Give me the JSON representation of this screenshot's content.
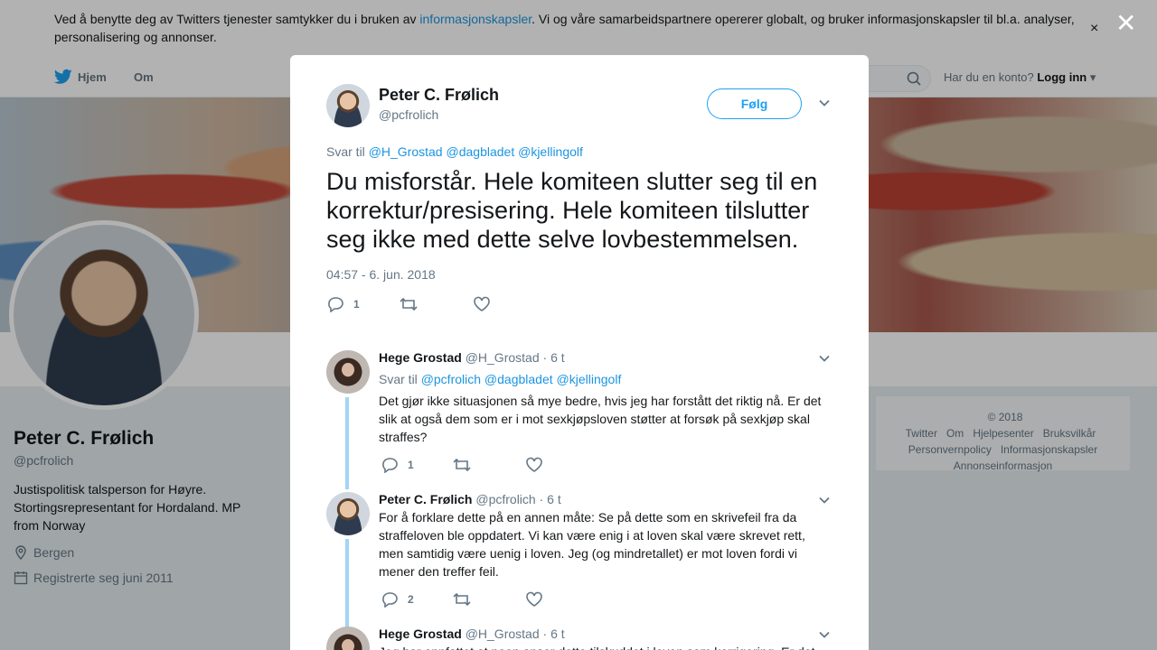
{
  "cookie": {
    "text_before": "Ved å benytte deg av Twitters tjenester samtykker du i bruken av ",
    "link": "informasjonskapsler",
    "text_after": ". Vi og våre samarbeidspartnere opererer globalt, og bruker informasjonskapsler til bl.a. analyser, personalisering og annonser.",
    "close": "×"
  },
  "modal_close": "✕",
  "nav": {
    "home": "Hjem",
    "about": "Om",
    "account_prompt": "Har du en konto? ",
    "login": "Logg inn"
  },
  "profile": {
    "name": "Peter C. Frølich",
    "handle": "@pcfrolich",
    "bio": "Justispolitisk talsperson for Høyre. Stortingsrepresentant for Hordaland. MP from Norway",
    "location": "Bergen",
    "joined": "Registrerte seg juni 2011"
  },
  "footer": [
    "© 2018 Twitter",
    "Om",
    "Hjelpesenter",
    "Bruksvilkår",
    "Personvernpolicy",
    "Informasjonskapsler",
    "Annonseinformasjon"
  ],
  "tweet": {
    "name": "Peter C. Frølich",
    "handle": "@pcfrolich",
    "follow": "Følg",
    "reply_to_label": "Svar til ",
    "reply_to": [
      "@H_Grostad",
      "@dagbladet",
      "@kjellingolf"
    ],
    "text": "Du misforstår. Hele komiteen slutter seg til en korrektur/presisering. Hele komiteen tilslutter seg ikke med dette selve lovbestemmelsen.",
    "time": "04:57 - 6. jun. 2018",
    "reply_count": "1",
    "retweet_count": "",
    "like_count": ""
  },
  "replies": [
    {
      "name": "Hege Grostad",
      "handle": "@H_Grostad",
      "age": "· 6 t",
      "reply_to_label": "Svar til ",
      "reply_to": [
        "@pcfrolich",
        "@dagbladet",
        "@kjellingolf"
      ],
      "text": "Det gjør ikke situasjonen så mye bedre, hvis jeg har forstått det riktig nå. Er det slik at også dem som er i mot sexkjøpsloven støtter at forsøk på sexkjøp skal straffes?",
      "reply_count": "1"
    },
    {
      "name": "Peter C. Frølich",
      "handle": "@pcfrolich",
      "age": "· 6 t",
      "text": "For å forklare dette på en annen måte: Se på dette som en skrivefeil fra da straffeloven ble oppdatert. Vi kan være enig i at loven skal være skrevet rett, men samtidig være uenig i loven. Jeg (og mindretallet) er mot loven fordi vi mener den treffer feil.",
      "reply_count": "2"
    },
    {
      "name": "Hege Grostad",
      "handle": "@H_Grostad",
      "age": "· 6 t",
      "text": "Jeg har oppfattet at noen anser dette tilskuddet i loven som korrigering. Er det"
    }
  ],
  "colors": {
    "twitter_blue": "#1da1f2",
    "thread_line": "#a3d4f5"
  }
}
